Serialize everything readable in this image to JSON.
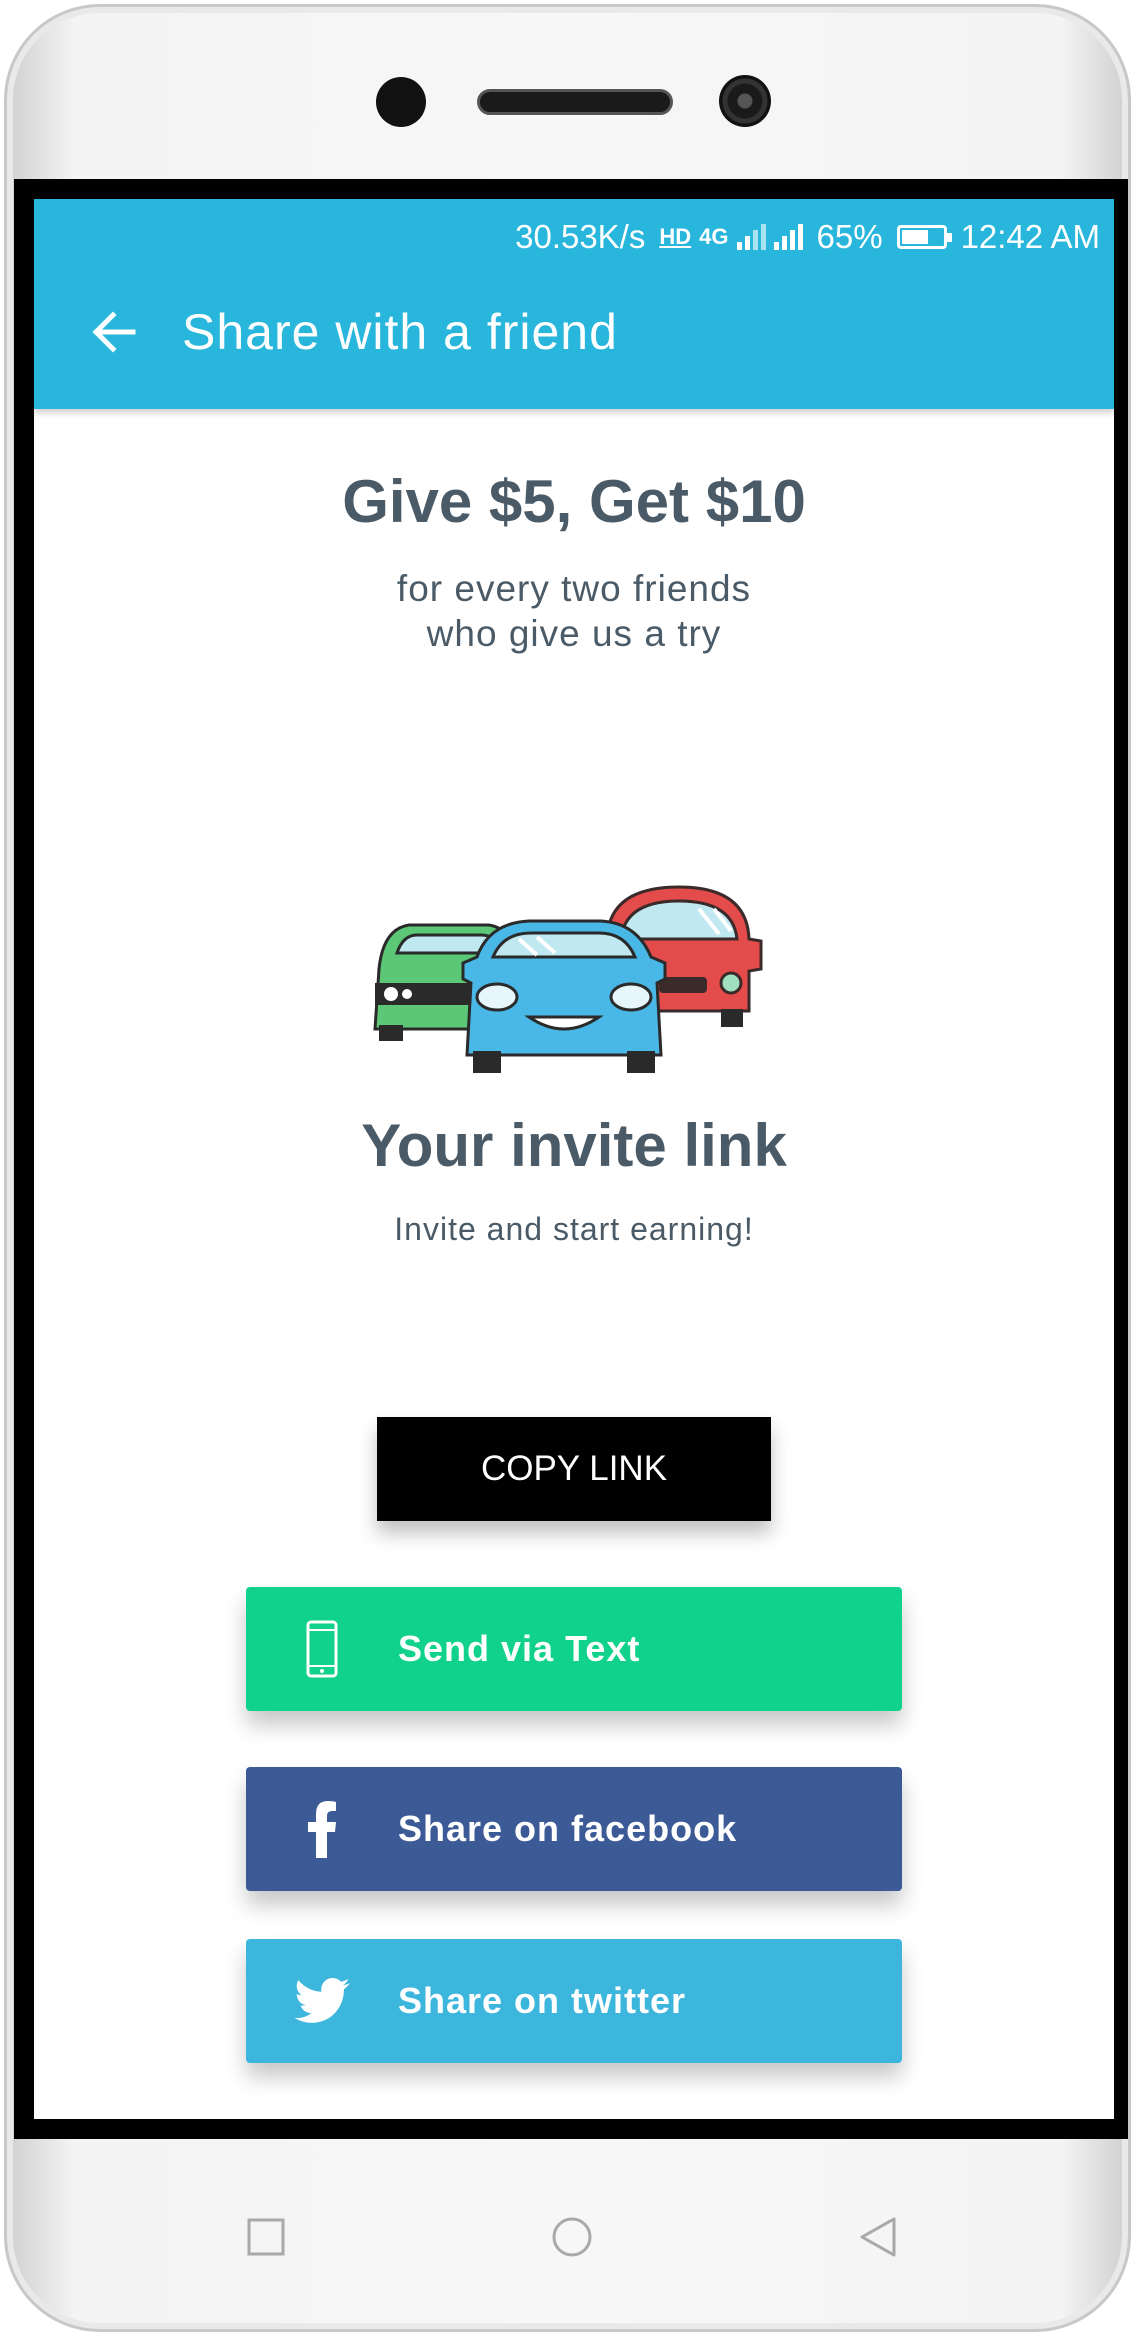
{
  "status_bar": {
    "speed": "30.53K/s",
    "network": "4G",
    "hd": "HD",
    "battery": "65%",
    "battery_level": 0.65,
    "time": "12:42 AM"
  },
  "app_bar": {
    "title": "Share with a friend",
    "back_icon": "arrow-left-icon",
    "background": "#29b6dc"
  },
  "promo": {
    "headline": "Give $5, Get $10",
    "subline_1": "for every two friends",
    "subline_2": "who give us a try",
    "illustration": "cars-illustration"
  },
  "invite": {
    "title": "Your invite link",
    "subtitle": "Invite and start earning!"
  },
  "actions": {
    "copy_link": "COPY LINK",
    "send_text": "Send via Text",
    "share_facebook": "Share on facebook",
    "share_twitter": "Share on twitter"
  },
  "colors": {
    "text_green": "#11d28c",
    "facebook_blue": "#3c5a96",
    "twitter_blue": "#3db6de",
    "heading": "#4a5a66"
  },
  "navigation": {
    "recents_icon": "square-icon",
    "home_icon": "circle-icon",
    "back_icon": "triangle-back-icon"
  }
}
